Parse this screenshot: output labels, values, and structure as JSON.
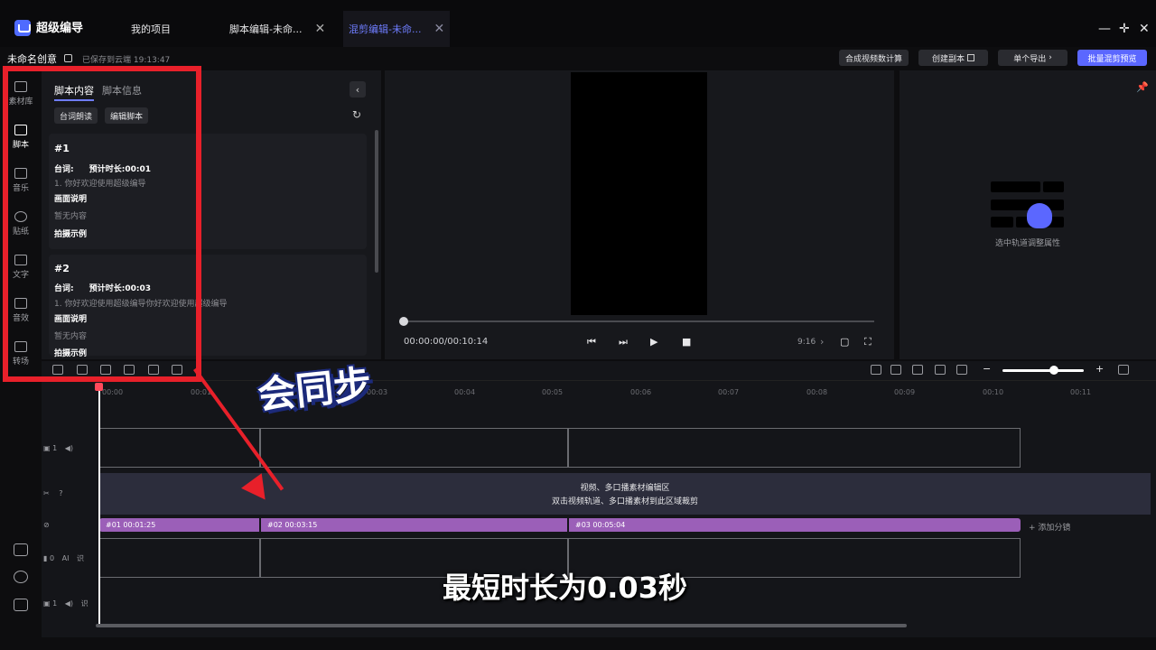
{
  "app": {
    "name": "超级编导"
  },
  "tabs": [
    {
      "label": "我的项目"
    },
    {
      "label": "脚本编辑-未命..."
    },
    {
      "label": "混剪编辑-未命..."
    }
  ],
  "window": {
    "minimize": "—",
    "maximize": "✛",
    "close": "✕"
  },
  "project": {
    "name": "未命名创意",
    "saved": "已保存到云端 19:13:47"
  },
  "toolbar": {
    "compose": "合成视频数计算",
    "create_copy": "创建副本",
    "single_export": "单个导出",
    "batch_preview": "批量混剪预览"
  },
  "rail": [
    {
      "label": "素材库",
      "icon": "media-library-icon"
    },
    {
      "label": "脚本",
      "icon": "script-icon"
    },
    {
      "label": "音乐",
      "icon": "music-icon"
    },
    {
      "label": "贴纸",
      "icon": "sticker-icon"
    },
    {
      "label": "文字",
      "icon": "text-icon"
    },
    {
      "label": "音效",
      "icon": "sound-effect-icon"
    },
    {
      "label": "转场",
      "icon": "transition-icon"
    }
  ],
  "script_panel": {
    "tab_content": "脚本内容",
    "tab_info": "脚本信息",
    "btn_read": "台词朗读",
    "btn_edit": "编辑脚本",
    "cards": [
      {
        "num": "#1",
        "line_label": "台词:",
        "duration": "预计时长:00:01",
        "line_text": "1. 你好欢迎使用超级编导",
        "desc_label": "画面说明",
        "desc_text": "暂无内容",
        "example_label": "拍摄示例"
      },
      {
        "num": "#2",
        "line_label": "台词:",
        "duration": "预计时长:00:03",
        "line_text": "1. 你好欢迎使用超级编导你好欢迎使用超级编导",
        "desc_label": "画面说明",
        "desc_text": "暂无内容",
        "example_label": "拍摄示例"
      }
    ]
  },
  "preview": {
    "timecode": "00:00:00/00:10:14",
    "ratio": "9:16",
    "progress": 0
  },
  "props": {
    "hint": "选中轨道调整属性"
  },
  "timeline": {
    "ticks": [
      "00:00",
      "00:01",
      "00:03",
      "00:04",
      "00:05",
      "00:06",
      "00:07",
      "00:08",
      "00:09",
      "00:10",
      "00:11"
    ],
    "main_area_line1": "视频、多口播素材编辑区",
    "main_area_line2": "双击视频轨道、多口播素材到此区域裁剪",
    "segments": [
      {
        "label": "#01  00:01:25"
      },
      {
        "label": "#02  00:03:15"
      },
      {
        "label": "#03  00:05:04"
      }
    ],
    "add_shot": "+ 添加分镜",
    "track_labels": [
      "1",
      "?",
      "0",
      "AI",
      "识",
      "1",
      "识"
    ]
  },
  "overlay": {
    "sync_text": "会同步",
    "subtitle": "最短时长为0.03秒"
  }
}
